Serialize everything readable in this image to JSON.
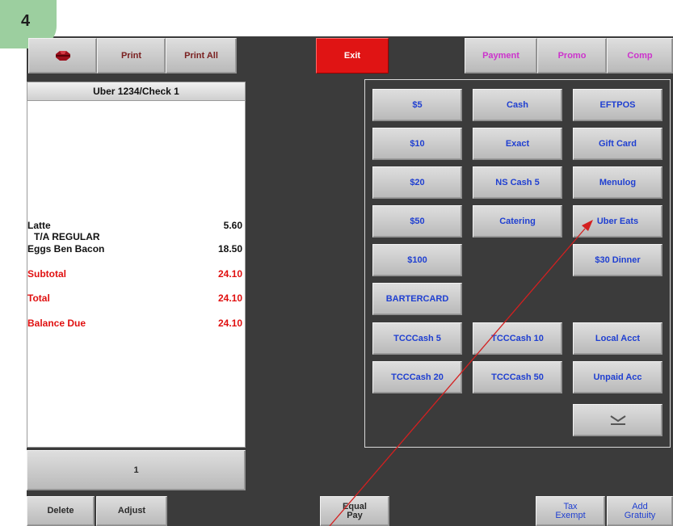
{
  "step_badge": "4",
  "top_bar": {
    "icon": "red-gem-icon",
    "print": "Print",
    "print_all": "Print All",
    "exit": "Exit",
    "payment": "Payment",
    "promo": "Promo",
    "comp": "Comp"
  },
  "receipt": {
    "title": "Uber  1234/Check 1",
    "items": [
      {
        "name": "Latte",
        "amount": "5.60"
      },
      {
        "name": "T/A REGULAR",
        "amount": ""
      },
      {
        "name": "Eggs Ben Bacon",
        "amount": "18.50"
      }
    ],
    "subtotal_label": "Subtotal",
    "subtotal_value": "24.10",
    "total_label": "Total",
    "total_value": "24.10",
    "balance_label": "Balance Due",
    "balance_value": "24.10",
    "page_number": "1"
  },
  "payment_buttons": [
    [
      "$5",
      "Cash",
      "EFTPOS"
    ],
    [
      "$10",
      "Exact",
      "Gift Card"
    ],
    [
      "$20",
      "NS Cash 5",
      "Menulog"
    ],
    [
      "$50",
      "Catering",
      "Uber Eats"
    ],
    [
      "$100",
      "",
      "$30 Dinner"
    ],
    [
      "BARTERCARD",
      "",
      ""
    ],
    [
      "TCCCash 5",
      "TCCCash 10",
      "Local Acct"
    ],
    [
      "TCCCash 20",
      "TCCCash 50",
      "Unpaid Acc"
    ]
  ],
  "collapse_icon": "chevron-collapse-icon",
  "bottom_bar": {
    "delete": "Delete",
    "adjust": "Adjust",
    "equal_pay_1": "Equal",
    "equal_pay_2": "Pay",
    "tax_exempt_1": "Tax",
    "tax_exempt_2": "Exempt",
    "add_gratuity_1": "Add",
    "add_gratuity_2": "Gratuity"
  },
  "colors": {
    "background": "#3b3b3b",
    "exit": "#e01414",
    "button_text_blue": "#1f3fd1",
    "button_text_pink": "#cc33cc",
    "totals_red": "#e01010",
    "annotation_arrow": "#d42020"
  }
}
